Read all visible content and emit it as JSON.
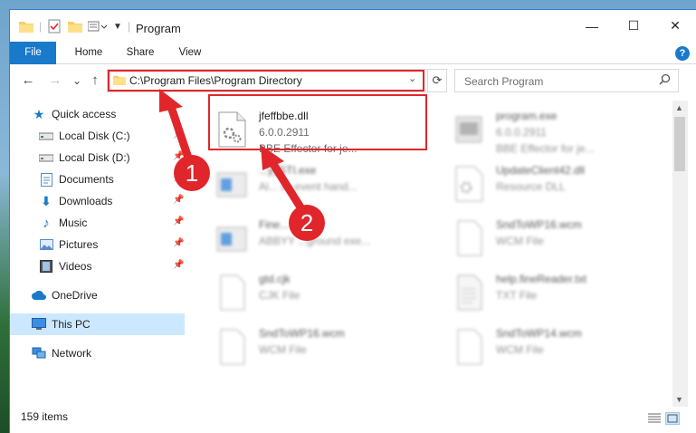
{
  "window": {
    "title": "Program",
    "controls": {
      "minimize": "—",
      "maximize": "☐",
      "close": "✕"
    }
  },
  "ribbon": {
    "tabs": [
      "File",
      "Home",
      "Share",
      "View"
    ],
    "help": "?"
  },
  "navigation": {
    "back": "←",
    "forward": "→",
    "recent": "⌄",
    "up": "↑",
    "address": "C:\\Program Files\\Program Directory",
    "address_dropdown": "⌄",
    "refresh": "⟳",
    "search_placeholder": "Search Program"
  },
  "sidebar": {
    "quick_access": {
      "label": "Quick access",
      "items": [
        {
          "label": "Local Disk (C:)",
          "icon": "drive-icon"
        },
        {
          "label": "Local Disk (D:)",
          "icon": "drive-icon"
        },
        {
          "label": "Documents",
          "icon": "documents-icon"
        },
        {
          "label": "Downloads",
          "icon": "downloads-icon"
        },
        {
          "label": "Music",
          "icon": "music-icon"
        },
        {
          "label": "Pictures",
          "icon": "pictures-icon"
        },
        {
          "label": "Videos",
          "icon": "videos-icon"
        }
      ]
    },
    "onedrive": "OneDrive",
    "this_pc": "This PC",
    "network": "Network"
  },
  "files": [
    {
      "name": "jfeffbbe.dll",
      "line1": "6.0.0.2911",
      "line2": "BBE Effector for je...",
      "icon": "dll-icon",
      "blurred": false
    },
    {
      "name": "program.exe",
      "line1": "6.0.0.2911",
      "line2": "BBE Effector for je...",
      "icon": "exe-icon",
      "blurred": true
    },
    {
      "name": "...yySTI.exe",
      "line1": "Al... sk event hand...",
      "line2": "",
      "icon": "exe-icon",
      "blurred": true
    },
    {
      "name": "UpdateClient42.dll",
      "line1": "Resource DLL",
      "line2": "",
      "icon": "dll-icon",
      "blurred": true
    },
    {
      "name": "Fine...",
      "line1": "ABBYY ...ground exe...",
      "line2": "",
      "icon": "exe-icon",
      "blurred": true
    },
    {
      "name": "SndToWP16.wcm",
      "line1": "WCM File",
      "line2": "",
      "icon": "file-icon",
      "blurred": true
    },
    {
      "name": "gtd.cjk",
      "line1": "CJK File",
      "line2": "",
      "icon": "file-icon",
      "blurred": true
    },
    {
      "name": "help.fineReader.txt",
      "line1": "TXT File",
      "line2": "",
      "icon": "text-file-icon",
      "blurred": true
    },
    {
      "name": "SndToWP16.wcm",
      "line1": "WCM File",
      "line2": "",
      "icon": "file-icon",
      "blurred": true
    },
    {
      "name": "SndToWP14.wcm",
      "line1": "WCM File",
      "line2": "",
      "icon": "file-icon",
      "blurred": true
    }
  ],
  "status": {
    "items": "159 items"
  },
  "annotations": [
    {
      "number": "1"
    },
    {
      "number": "2"
    }
  ],
  "colors": {
    "accent": "#1979ca",
    "annotation": "#e0262b",
    "selected": "#cce8ff"
  }
}
